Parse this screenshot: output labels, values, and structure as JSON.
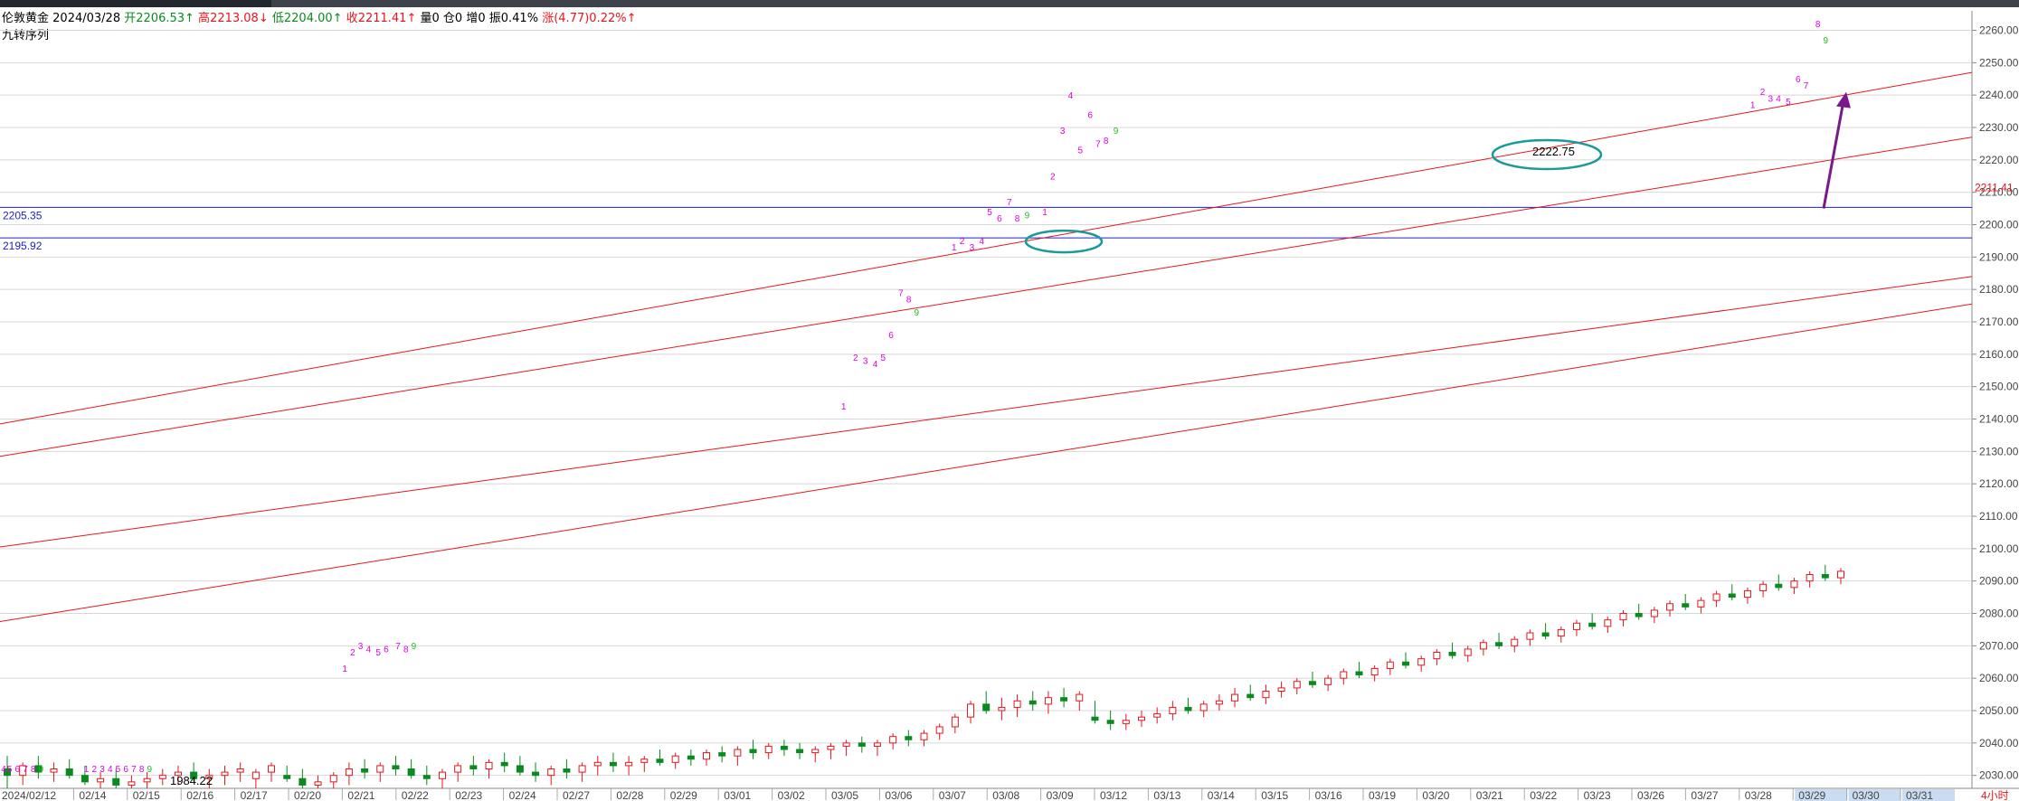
{
  "header": {
    "instrument": "伦敦黄金",
    "date": "2024/03/28",
    "open_label": "开",
    "open": "2206.53↑",
    "high_label": "高",
    "high": "2213.08↓",
    "low_label": "低",
    "low": "2204.00↑",
    "close_label": "收",
    "close": "2211.41↑",
    "volume": "量0",
    "position": "仓0",
    "increase": "增0",
    "amplitude": "振0.41%",
    "change_label": "涨",
    "change": "(4.77)0.22%↑"
  },
  "indicator_name": "九转序列",
  "colors": {
    "up": "#e8151b",
    "down": "#0a8a1f",
    "trend": "#e8151b",
    "hline": "#2020c8",
    "circle": "#1a9a9a",
    "arrow": "#7a1a8a",
    "grid": "#d8d8d8",
    "seq_pink": "#e000e0",
    "seq_green": "#20c020",
    "axis_text": "#444444",
    "highlight": "#c9dcf2"
  },
  "chart_data": {
    "type": "candlestick",
    "ylim": [
      2026,
      2266
    ],
    "y_ticks": [
      "2260.00",
      "2250.00",
      "2240.00",
      "2230.00",
      "2220.00",
      "2210.00",
      "2200.00",
      "2190.00",
      "2180.00",
      "2170.00",
      "2160.00",
      "2150.00",
      "2140.00",
      "2130.00",
      "2120.00",
      "2110.00",
      "2100.00",
      "2090.00",
      "2080.00",
      "2070.00",
      "2060.00",
      "2050.00",
      "2040.00",
      "2030.00"
    ],
    "x_labels": [
      "2024/02/12",
      "02/14",
      "02/15",
      "02/16",
      "02/17",
      "02/20",
      "02/21",
      "02/22",
      "02/23",
      "02/24",
      "02/27",
      "02/28",
      "02/29",
      "03/01",
      "03/02",
      "03/05",
      "03/06",
      "03/07",
      "03/08",
      "03/09",
      "03/12",
      "03/13",
      "03/14",
      "03/15",
      "03/16",
      "03/19",
      "03/20",
      "03/21",
      "03/22",
      "03/23",
      "03/26",
      "03/27",
      "03/28",
      "03/29",
      "03/30",
      "03/31"
    ],
    "x_highlighted": [
      "03/29",
      "03/30",
      "03/31"
    ],
    "period_label": "4小时",
    "current_price": "2211.41",
    "horizontal_lines": [
      {
        "value": 2205.35,
        "label": "2205.35"
      },
      {
        "value": 2195.92,
        "label": "2195.92"
      }
    ],
    "annotations": [
      {
        "text": "2222.75",
        "value": 2222.75
      },
      {
        "text": "1984.22",
        "value": 1984.22
      }
    ],
    "trend_lines": [
      {
        "x1": 0,
        "y1": 2138.5,
        "x2": 1,
        "y2": 2247
      },
      {
        "x1": 0,
        "y1": 2128.5,
        "x2": 1,
        "y2": 2227
      },
      {
        "x1": 0,
        "y1": 2100.5,
        "x2": 1,
        "y2": 2184
      },
      {
        "x1": 0,
        "y1": 2077.5,
        "x2": 1,
        "y2": 2175.5
      }
    ],
    "candles": [
      {
        "o": 2032,
        "h": 2036,
        "l": 2026,
        "c": 2030
      },
      {
        "o": 2030,
        "h": 2034,
        "l": 2027,
        "c": 2033
      },
      {
        "o": 2033,
        "h": 2036,
        "l": 2029,
        "c": 2031
      },
      {
        "o": 2031,
        "h": 2034,
        "l": 2028,
        "c": 2032
      },
      {
        "o": 2032,
        "h": 2035,
        "l": 2029,
        "c": 2030
      },
      {
        "o": 2030,
        "h": 2033,
        "l": 2027,
        "c": 2028
      },
      {
        "o": 2028,
        "h": 2031,
        "l": 2026,
        "c": 2029
      },
      {
        "o": 2029,
        "h": 2032,
        "l": 2026,
        "c": 2027
      },
      {
        "o": 2027,
        "h": 2030,
        "l": 2026,
        "c": 2028
      },
      {
        "o": 2028,
        "h": 2031,
        "l": 2026,
        "c": 2029
      },
      {
        "o": 2029,
        "h": 2032,
        "l": 2027,
        "c": 2030
      },
      {
        "o": 2030,
        "h": 2033,
        "l": 2027,
        "c": 2031
      },
      {
        "o": 2031,
        "h": 2034,
        "l": 2028,
        "c": 2029
      },
      {
        "o": 2029,
        "h": 2032,
        "l": 2026,
        "c": 2030
      },
      {
        "o": 2030,
        "h": 2033,
        "l": 2027,
        "c": 2031
      },
      {
        "o": 2031,
        "h": 2034,
        "l": 2028,
        "c": 2032
      },
      {
        "o": 2029,
        "h": 2032,
        "l": 2026,
        "c": 2031
      },
      {
        "o": 2031,
        "h": 2034,
        "l": 2028,
        "c": 2033
      },
      {
        "o": 2030,
        "h": 2033,
        "l": 2028,
        "c": 2029
      },
      {
        "o": 2029,
        "h": 2032,
        "l": 2026,
        "c": 2027
      },
      {
        "o": 2027,
        "h": 2030,
        "l": 2026,
        "c": 2028
      },
      {
        "o": 2028,
        "h": 2031,
        "l": 2026,
        "c": 2030
      },
      {
        "o": 2030,
        "h": 2034,
        "l": 2027,
        "c": 2032
      },
      {
        "o": 2032,
        "h": 2035,
        "l": 2029,
        "c": 2031
      },
      {
        "o": 2031,
        "h": 2034,
        "l": 2028,
        "c": 2033
      },
      {
        "o": 2033,
        "h": 2036,
        "l": 2030,
        "c": 2032
      },
      {
        "o": 2032,
        "h": 2035,
        "l": 2029,
        "c": 2030
      },
      {
        "o": 2030,
        "h": 2033,
        "l": 2027,
        "c": 2029
      },
      {
        "o": 2029,
        "h": 2032,
        "l": 2026,
        "c": 2031
      },
      {
        "o": 2031,
        "h": 2034,
        "l": 2028,
        "c": 2033
      },
      {
        "o": 2033,
        "h": 2036,
        "l": 2030,
        "c": 2032
      },
      {
        "o": 2032,
        "h": 2035,
        "l": 2029,
        "c": 2034
      },
      {
        "o": 2034,
        "h": 2037,
        "l": 2031,
        "c": 2033
      },
      {
        "o": 2033,
        "h": 2036,
        "l": 2030,
        "c": 2031
      },
      {
        "o": 2031,
        "h": 2034,
        "l": 2028,
        "c": 2030
      },
      {
        "o": 2030,
        "h": 2033,
        "l": 2027,
        "c": 2032
      },
      {
        "o": 2032,
        "h": 2035,
        "l": 2029,
        "c": 2031
      },
      {
        "o": 2031,
        "h": 2034,
        "l": 2028,
        "c": 2033
      },
      {
        "o": 2033,
        "h": 2036,
        "l": 2030,
        "c": 2034
      },
      {
        "o": 2034,
        "h": 2037,
        "l": 2031,
        "c": 2033
      },
      {
        "o": 2033,
        "h": 2036,
        "l": 2030,
        "c": 2034
      },
      {
        "o": 2034,
        "h": 2036,
        "l": 2031,
        "c": 2035
      },
      {
        "o": 2035,
        "h": 2038,
        "l": 2033,
        "c": 2034
      },
      {
        "o": 2034,
        "h": 2037,
        "l": 2032,
        "c": 2036
      },
      {
        "o": 2036,
        "h": 2038,
        "l": 2033,
        "c": 2035
      },
      {
        "o": 2035,
        "h": 2038,
        "l": 2033,
        "c": 2037
      },
      {
        "o": 2037,
        "h": 2039,
        "l": 2034,
        "c": 2036
      },
      {
        "o": 2036,
        "h": 2039,
        "l": 2033,
        "c": 2038
      },
      {
        "o": 2038,
        "h": 2041,
        "l": 2035,
        "c": 2037
      },
      {
        "o": 2037,
        "h": 2040,
        "l": 2035,
        "c": 2039
      },
      {
        "o": 2039,
        "h": 2041,
        "l": 2036,
        "c": 2038
      },
      {
        "o": 2038,
        "h": 2040,
        "l": 2035,
        "c": 2037
      },
      {
        "o": 2037,
        "h": 2039,
        "l": 2034,
        "c": 2038
      },
      {
        "o": 2038,
        "h": 2040,
        "l": 2035,
        "c": 2039
      },
      {
        "o": 2039,
        "h": 2041,
        "l": 2036,
        "c": 2040
      },
      {
        "o": 2040,
        "h": 2042,
        "l": 2037,
        "c": 2039
      },
      {
        "o": 2039,
        "h": 2041,
        "l": 2036,
        "c": 2040
      },
      {
        "o": 2040,
        "h": 2043,
        "l": 2038,
        "c": 2042
      },
      {
        "o": 2042,
        "h": 2044,
        "l": 2039,
        "c": 2041
      },
      {
        "o": 2041,
        "h": 2044,
        "l": 2039,
        "c": 2043
      },
      {
        "o": 2043,
        "h": 2046,
        "l": 2041,
        "c": 2045
      },
      {
        "o": 2045,
        "h": 2049,
        "l": 2043,
        "c": 2048
      },
      {
        "o": 2048,
        "h": 2053,
        "l": 2046,
        "c": 2052
      },
      {
        "o": 2052,
        "h": 2056,
        "l": 2049,
        "c": 2050
      },
      {
        "o": 2050,
        "h": 2054,
        "l": 2047,
        "c": 2051
      },
      {
        "o": 2051,
        "h": 2055,
        "l": 2048,
        "c": 2053
      },
      {
        "o": 2053,
        "h": 2056,
        "l": 2050,
        "c": 2052
      },
      {
        "o": 2052,
        "h": 2056,
        "l": 2049,
        "c": 2054
      },
      {
        "o": 2054,
        "h": 2057,
        "l": 2051,
        "c": 2053
      },
      {
        "o": 2053,
        "h": 2056,
        "l": 2050,
        "c": 2055
      },
      {
        "o": 2048,
        "h": 2053,
        "l": 2046,
        "c": 2047
      },
      {
        "o": 2047,
        "h": 2050,
        "l": 2044,
        "c": 2046
      },
      {
        "o": 2046,
        "h": 2049,
        "l": 2044,
        "c": 2047
      },
      {
        "o": 2047,
        "h": 2050,
        "l": 2045,
        "c": 2048
      },
      {
        "o": 2048,
        "h": 2051,
        "l": 2046,
        "c": 2049
      },
      {
        "o": 2049,
        "h": 2053,
        "l": 2047,
        "c": 2051
      },
      {
        "o": 2051,
        "h": 2054,
        "l": 2049,
        "c": 2050
      },
      {
        "o": 2050,
        "h": 2053,
        "l": 2048,
        "c": 2052
      },
      {
        "o": 2052,
        "h": 2055,
        "l": 2050,
        "c": 2053
      },
      {
        "o": 2053,
        "h": 2057,
        "l": 2051,
        "c": 2055
      },
      {
        "o": 2055,
        "h": 2058,
        "l": 2053,
        "c": 2054
      },
      {
        "o": 2054,
        "h": 2058,
        "l": 2052,
        "c": 2056
      },
      {
        "o": 2056,
        "h": 2059,
        "l": 2054,
        "c": 2057
      },
      {
        "o": 2057,
        "h": 2060,
        "l": 2055,
        "c": 2059
      },
      {
        "o": 2059,
        "h": 2062,
        "l": 2057,
        "c": 2058
      },
      {
        "o": 2058,
        "h": 2061,
        "l": 2056,
        "c": 2060
      },
      {
        "o": 2060,
        "h": 2063,
        "l": 2058,
        "c": 2062
      },
      {
        "o": 2062,
        "h": 2065,
        "l": 2060,
        "c": 2061
      },
      {
        "o": 2061,
        "h": 2064,
        "l": 2059,
        "c": 2063
      },
      {
        "o": 2063,
        "h": 2066,
        "l": 2061,
        "c": 2065
      },
      {
        "o": 2065,
        "h": 2068,
        "l": 2063,
        "c": 2064
      },
      {
        "o": 2064,
        "h": 2067,
        "l": 2062,
        "c": 2066
      },
      {
        "o": 2066,
        "h": 2069,
        "l": 2064,
        "c": 2068
      },
      {
        "o": 2068,
        "h": 2071,
        "l": 2066,
        "c": 2067
      },
      {
        "o": 2067,
        "h": 2070,
        "l": 2065,
        "c": 2069
      },
      {
        "o": 2069,
        "h": 2072,
        "l": 2067,
        "c": 2071
      },
      {
        "o": 2071,
        "h": 2074,
        "l": 2069,
        "c": 2070
      },
      {
        "o": 2070,
        "h": 2073,
        "l": 2068,
        "c": 2072
      },
      {
        "o": 2072,
        "h": 2075,
        "l": 2070,
        "c": 2074
      },
      {
        "o": 2074,
        "h": 2077,
        "l": 2072,
        "c": 2073
      },
      {
        "o": 2073,
        "h": 2076,
        "l": 2071,
        "c": 2075
      },
      {
        "o": 2075,
        "h": 2078,
        "l": 2073,
        "c": 2077
      },
      {
        "o": 2077,
        "h": 2080,
        "l": 2075,
        "c": 2076
      },
      {
        "o": 2076,
        "h": 2079,
        "l": 2074,
        "c": 2078
      },
      {
        "o": 2078,
        "h": 2081,
        "l": 2076,
        "c": 2080
      },
      {
        "o": 2080,
        "h": 2083,
        "l": 2078,
        "c": 2079
      },
      {
        "o": 2079,
        "h": 2082,
        "l": 2077,
        "c": 2081
      },
      {
        "o": 2081,
        "h": 2084,
        "l": 2079,
        "c": 2083
      },
      {
        "o": 2083,
        "h": 2086,
        "l": 2081,
        "c": 2082
      },
      {
        "o": 2082,
        "h": 2085,
        "l": 2080,
        "c": 2084
      },
      {
        "o": 2084,
        "h": 2087,
        "l": 2082,
        "c": 2086
      },
      {
        "o": 2086,
        "h": 2089,
        "l": 2084,
        "c": 2085
      },
      {
        "o": 2085,
        "h": 2088,
        "l": 2083,
        "c": 2087
      },
      {
        "o": 2087,
        "h": 2090,
        "l": 2085,
        "c": 2089
      },
      {
        "o": 2089,
        "h": 2092,
        "l": 2087,
        "c": 2088
      },
      {
        "o": 2088,
        "h": 2091,
        "l": 2086,
        "c": 2090
      },
      {
        "o": 2090,
        "h": 2093,
        "l": 2088,
        "c": 2092
      },
      {
        "o": 2092,
        "h": 2095,
        "l": 2090,
        "c": 2091
      },
      {
        "o": 2091,
        "h": 2094,
        "l": 2089,
        "c": 2093
      }
    ],
    "sequence_labels": [
      {
        "text": "4",
        "v": 2031,
        "pos": 0.0
      },
      {
        "text": "5",
        "v": 2031,
        "pos": 0.003
      },
      {
        "text": "6",
        "v": 2031,
        "pos": 0.007
      },
      {
        "text": "7",
        "v": 2031,
        "pos": 0.011
      },
      {
        "text": "8",
        "v": 2031,
        "pos": 0.015
      },
      {
        "text": "9",
        "v": 2031,
        "pos": 0.019
      },
      {
        "text": "1",
        "v": 2031,
        "pos": 0.042
      },
      {
        "text": "2",
        "v": 2031,
        "pos": 0.046
      },
      {
        "text": "3",
        "v": 2031,
        "pos": 0.05
      },
      {
        "text": "4",
        "v": 2031,
        "pos": 0.054
      },
      {
        "text": "5",
        "v": 2031,
        "pos": 0.058
      },
      {
        "text": "6",
        "v": 2031,
        "pos": 0.062
      },
      {
        "text": "7",
        "v": 2031,
        "pos": 0.066
      },
      {
        "text": "8",
        "v": 2031,
        "pos": 0.07
      },
      {
        "text": "9",
        "v": 2031,
        "pos": 0.074
      },
      {
        "text": "1",
        "v": 2062,
        "pos": 0.173
      },
      {
        "text": "2",
        "v": 2067,
        "pos": 0.177
      },
      {
        "text": "3",
        "v": 2069,
        "pos": 0.181
      },
      {
        "text": "4",
        "v": 2068,
        "pos": 0.185
      },
      {
        "text": "5",
        "v": 2067,
        "pos": 0.19
      },
      {
        "text": "6",
        "v": 2068,
        "pos": 0.194
      },
      {
        "text": "7",
        "v": 2069,
        "pos": 0.2
      },
      {
        "text": "8",
        "v": 2068,
        "pos": 0.204
      },
      {
        "text": "9",
        "v": 2069,
        "pos": 0.208
      },
      {
        "text": "1",
        "v": 2143,
        "pos": 0.426
      },
      {
        "text": "2",
        "v": 2158,
        "pos": 0.432
      },
      {
        "text": "3",
        "v": 2157,
        "pos": 0.437
      },
      {
        "text": "4",
        "v": 2156,
        "pos": 0.442
      },
      {
        "text": "5",
        "v": 2158,
        "pos": 0.446
      },
      {
        "text": "6",
        "v": 2165,
        "pos": 0.45
      },
      {
        "text": "7",
        "v": 2178,
        "pos": 0.455
      },
      {
        "text": "8",
        "v": 2176,
        "pos": 0.459
      },
      {
        "text": "9",
        "v": 2172,
        "pos": 0.463
      },
      {
        "text": "1",
        "v": 2192,
        "pos": 0.482
      },
      {
        "text": "2",
        "v": 2194,
        "pos": 0.486
      },
      {
        "text": "3",
        "v": 2192,
        "pos": 0.491
      },
      {
        "text": "4",
        "v": 2194,
        "pos": 0.496
      },
      {
        "text": "5",
        "v": 2203,
        "pos": 0.5
      },
      {
        "text": "6",
        "v": 2201,
        "pos": 0.505
      },
      {
        "text": "7",
        "v": 2206,
        "pos": 0.51
      },
      {
        "text": "8",
        "v": 2201,
        "pos": 0.514
      },
      {
        "text": "9",
        "v": 2202,
        "pos": 0.519
      },
      {
        "text": "1",
        "v": 2203,
        "pos": 0.528
      },
      {
        "text": "2",
        "v": 2214,
        "pos": 0.532
      },
      {
        "text": "3",
        "v": 2228,
        "pos": 0.537
      },
      {
        "text": "4",
        "v": 2239,
        "pos": 0.541
      },
      {
        "text": "5",
        "v": 2222,
        "pos": 0.546
      },
      {
        "text": "6",
        "v": 2233,
        "pos": 0.551
      },
      {
        "text": "7",
        "v": 2224,
        "pos": 0.555
      },
      {
        "text": "8",
        "v": 2225,
        "pos": 0.559
      },
      {
        "text": "9",
        "v": 2228,
        "pos": 0.564
      },
      {
        "text": "1",
        "v": 2236,
        "pos": 0.887
      },
      {
        "text": "2",
        "v": 2240,
        "pos": 0.892
      },
      {
        "text": "3",
        "v": 2238,
        "pos": 0.896
      },
      {
        "text": "4",
        "v": 2238,
        "pos": 0.9
      },
      {
        "text": "5",
        "v": 2237,
        "pos": 0.905
      },
      {
        "text": "6",
        "v": 2244,
        "pos": 0.91
      },
      {
        "text": "7",
        "v": 2242,
        "pos": 0.914
      },
      {
        "text": "8",
        "v": 2261,
        "pos": 0.92
      },
      {
        "text": "9",
        "v": 2256,
        "pos": 0.924
      }
    ]
  }
}
